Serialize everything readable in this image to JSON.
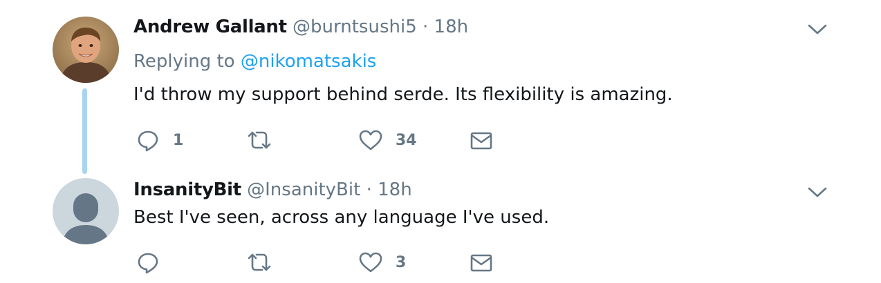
{
  "thread": {
    "tweets": [
      {
        "author_name": "Andrew Gallant",
        "handle": "@burntsushi5",
        "separator": "·",
        "time": "18h",
        "replying_to_label": "Replying to",
        "replying_to_handle": "@nikomatsakis",
        "text": "I'd throw my support behind serde. Its flexibility is amazing.",
        "replies": "1",
        "retweets": "",
        "likes": "34",
        "avatar_icon": "photo-avatar"
      },
      {
        "author_name": "InsanityBit",
        "handle": "@InsanityBit",
        "separator": "·",
        "time": "18h",
        "text": "Best I've seen, across any language I've used.",
        "replies": "",
        "retweets": "",
        "likes": "3",
        "avatar_icon": "default-avatar"
      }
    ]
  },
  "colors": {
    "text": "#14171a",
    "secondary": "#657786",
    "link": "#1da1f2",
    "thread_line": "#a9d4f0",
    "default_avatar_bg": "#ccd6dd"
  },
  "icons": [
    "reply-icon",
    "retweet-icon",
    "like-icon",
    "direct-message-icon",
    "caret-down-icon"
  ]
}
